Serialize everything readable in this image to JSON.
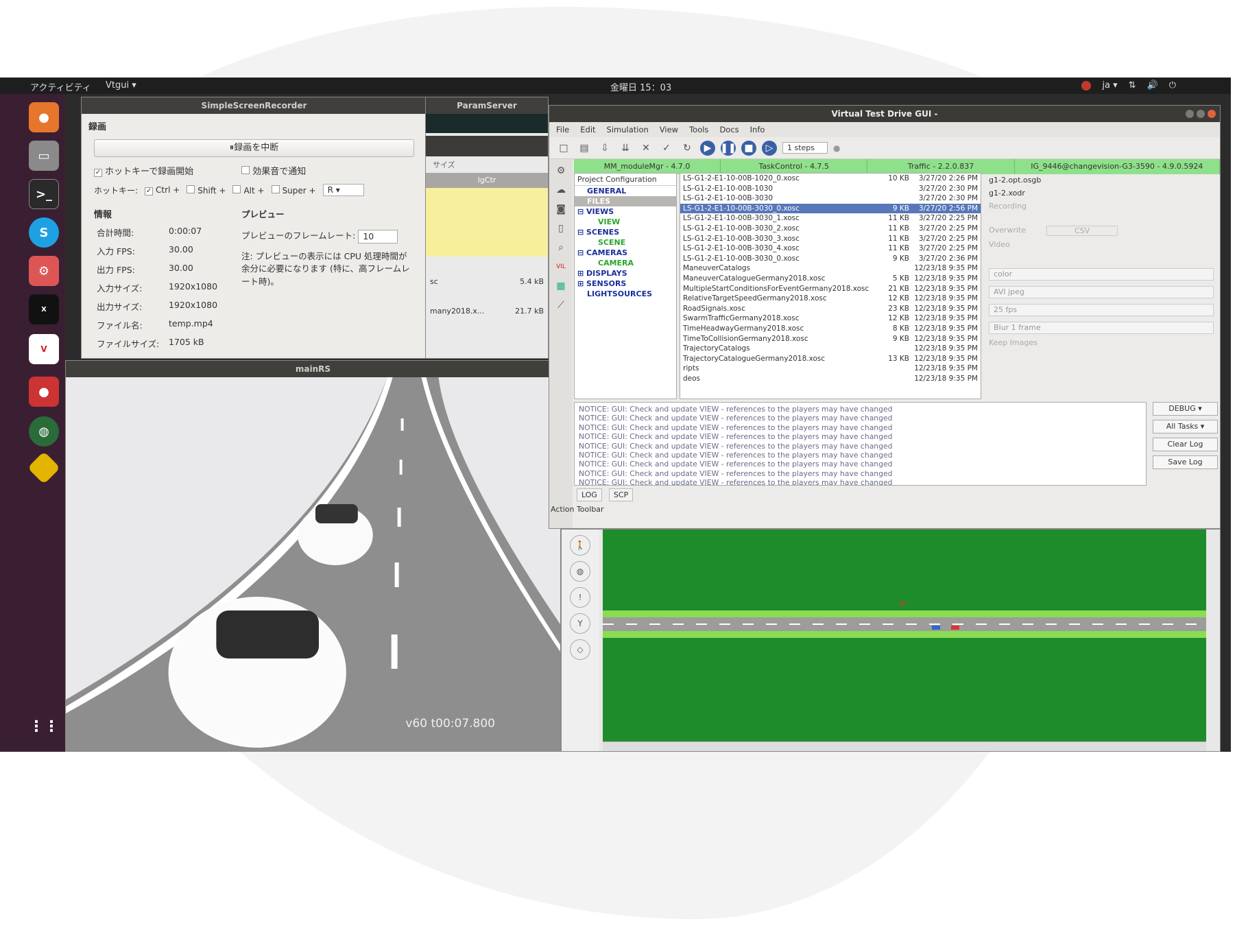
{
  "topbar": {
    "activities": "アクティビティ",
    "app_menu": "Vtgui ▾",
    "clock": "金曜日 15：03",
    "lang": "ja ▾"
  },
  "dock": {
    "items": [
      "firefox-icon",
      "files-icon",
      "terminal-icon",
      "skype-icon",
      "settings-icon",
      "xterm-icon",
      "vires-icon",
      "record-icon",
      "globe-icon",
      "car-sign-icon",
      "app-grid-icon"
    ]
  },
  "ssr": {
    "title": "SimpleScreenRecorder",
    "section_record": "録画",
    "pause_button": "⏸録画を中断",
    "hotkey_start": "ホットキーで録画開始",
    "sound_notify": "効果音で通知",
    "hotkey_label": "ホットキー:",
    "mod_ctrl": "Ctrl +",
    "mod_shift": "Shift +",
    "mod_alt": "Alt +",
    "mod_super": "Super +",
    "key": "R",
    "info_title": "情報",
    "preview_title": "プレビュー",
    "info": [
      {
        "k": "合計時間:",
        "v": "0:00:07"
      },
      {
        "k": "入力 FPS:",
        "v": "30.00"
      },
      {
        "k": "出力 FPS:",
        "v": "30.00"
      },
      {
        "k": "入力サイズ:",
        "v": "1920x1080"
      },
      {
        "k": "出力サイズ:",
        "v": "1920x1080"
      },
      {
        "k": "ファイル名:",
        "v": "temp.mp4"
      },
      {
        "k": "ファイルサイズ:",
        "v": "1705 kB"
      }
    ],
    "preview_rate_label": "プレビューのフレームレート:",
    "preview_rate": "10",
    "preview_note": "注: プレビューの表示には CPU 処理時間が余分に必要になります (特に、高フレームレート時)。"
  },
  "param": {
    "title": "ParamServer",
    "size_col": "サイズ",
    "tab": "lgCtr",
    "file1_name": "sc",
    "file1_size": "5.4 kB",
    "file2_name": "many2018.x...",
    "file2_size": "21.7 kB"
  },
  "mainrs": {
    "title": "mainRS",
    "overlay": "v60 t00:07.800"
  },
  "vtd": {
    "title": "Virtual Test Drive GUI -",
    "menu": [
      "File",
      "Edit",
      "Simulation",
      "View",
      "Tools",
      "Docs",
      "Info"
    ],
    "steps": "1 steps",
    "status": [
      "MM_moduleMgr - 4.7.0",
      "TaskControl - 4.7.5",
      "Traffic - 2.2.0.837",
      "IG_9446@changevision-G3-3590 - 4.9.0.5924"
    ],
    "tree_header": "Project Configuration",
    "tree": {
      "general": "GENERAL",
      "files": "FILES",
      "views": "VIEWS",
      "view": "VIEW",
      "scenes": "SCENES",
      "scene": "SCENE",
      "cameras": "CAMERAS",
      "camera": "CAMERA",
      "displays": "DISPLAYS",
      "sensors": "SENSORS",
      "lightsources": "LIGHTSOURCES"
    },
    "files": [
      {
        "n": "LS-G1-2-E1-10-00B-1020_0.xosc",
        "s": "10 KB",
        "d": "3/27/20 2:26 PM"
      },
      {
        "n": "LS-G1-2-E1-10-00B-1030",
        "s": "",
        "d": "3/27/20 2:30 PM"
      },
      {
        "n": "LS-G1-2-E1-10-00B-3030",
        "s": "",
        "d": "3/27/20 2:30 PM"
      },
      {
        "n": "LS-G1-2-E1-10-00B-3030_0.xosc",
        "s": "9 KB",
        "d": "3/27/20 2:56 PM"
      },
      {
        "n": "LS-G1-2-E1-10-00B-3030_1.xosc",
        "s": "11 KB",
        "d": "3/27/20 2:25 PM"
      },
      {
        "n": "LS-G1-2-E1-10-00B-3030_2.xosc",
        "s": "11 KB",
        "d": "3/27/20 2:25 PM"
      },
      {
        "n": "LS-G1-2-E1-10-00B-3030_3.xosc",
        "s": "11 KB",
        "d": "3/27/20 2:25 PM"
      },
      {
        "n": "LS-G1-2-E1-10-00B-3030_4.xosc",
        "s": "11 KB",
        "d": "3/27/20 2:25 PM"
      },
      {
        "n": "LS-G1-2-E1-10-00B-3030_0.xosc",
        "s": "9 KB",
        "d": "3/27/20 2:36 PM"
      },
      {
        "n": "ManeuverCatalogs",
        "s": "",
        "d": "12/23/18 9:35 PM"
      },
      {
        "n": "ManeuverCatalogueGermany2018.xosc",
        "s": "5 KB",
        "d": "12/23/18 9:35 PM"
      },
      {
        "n": "MultipleStartConditionsForEventGermany2018.xosc",
        "s": "21 KB",
        "d": "12/23/18 9:35 PM"
      },
      {
        "n": "RelativeTargetSpeedGermany2018.xosc",
        "s": "12 KB",
        "d": "12/23/18 9:35 PM"
      },
      {
        "n": "RoadSignals.xosc",
        "s": "23 KB",
        "d": "12/23/18 9:35 PM"
      },
      {
        "n": "SwarmTrafficGermany2018.xosc",
        "s": "12 KB",
        "d": "12/23/18 9:35 PM"
      },
      {
        "n": "TimeHeadwayGermany2018.xosc",
        "s": "8 KB",
        "d": "12/23/18 9:35 PM"
      },
      {
        "n": "TimeToCollisionGermany2018.xosc",
        "s": "9 KB",
        "d": "12/23/18 9:35 PM"
      },
      {
        "n": "TrajectoryCatalogs",
        "s": "",
        "d": "12/23/18 9:35 PM"
      },
      {
        "n": "TrajectoryCatalogueGermany2018.xosc",
        "s": "13 KB",
        "d": "12/23/18 9:35 PM"
      },
      {
        "n": "ripts",
        "s": "",
        "d": "12/23/18 9:35 PM"
      },
      {
        "n": "deos",
        "s": "",
        "d": "12/23/18 9:35 PM"
      }
    ],
    "right": {
      "file1": "g1-2.opt.osgb",
      "file2": "g1-2.xodr",
      "recording": "Recording",
      "overwrite": "Overwrite",
      "csv": "CSV",
      "video": "Video",
      "color": "color",
      "codec": "AVI jpeg",
      "fps": "25 fps",
      "blur": "Blur 1 frame",
      "keep": "Keep Images"
    },
    "log": [
      "NOTICE:   GUI: Check and update VIEW - references to the players may have changed",
      "NOTICE:   GUI: Check and update VIEW - references to the players may have changed",
      "NOTICE:   GUI: Check and update VIEW - references to the players may have changed",
      "NOTICE:   GUI: Check and update VIEW - references to the players may have changed",
      "NOTICE:   GUI: Check and update VIEW - references to the players may have changed",
      "NOTICE:   GUI: Check and update VIEW - references to the players may have changed",
      "NOTICE:   GUI: Check and update VIEW - references to the players may have changed",
      "NOTICE:   GUI: Check and update VIEW - references to the players may have changed",
      "NOTICE:   GUI: Check and update VIEW - references to the players may have changed"
    ],
    "log_level": "DEBUG ▾",
    "log_tasks": "All Tasks ▾",
    "clear_log": "Clear Log",
    "save_log": "Save Log",
    "tab_log": "LOG",
    "tab_scp": "SCP",
    "action_toolbar": "Action Toolbar"
  },
  "colors": {
    "status_green": "#8fe08a",
    "map_green": "#1f8c2b",
    "dock": "#3a1f33",
    "selection": "#5877b8"
  }
}
